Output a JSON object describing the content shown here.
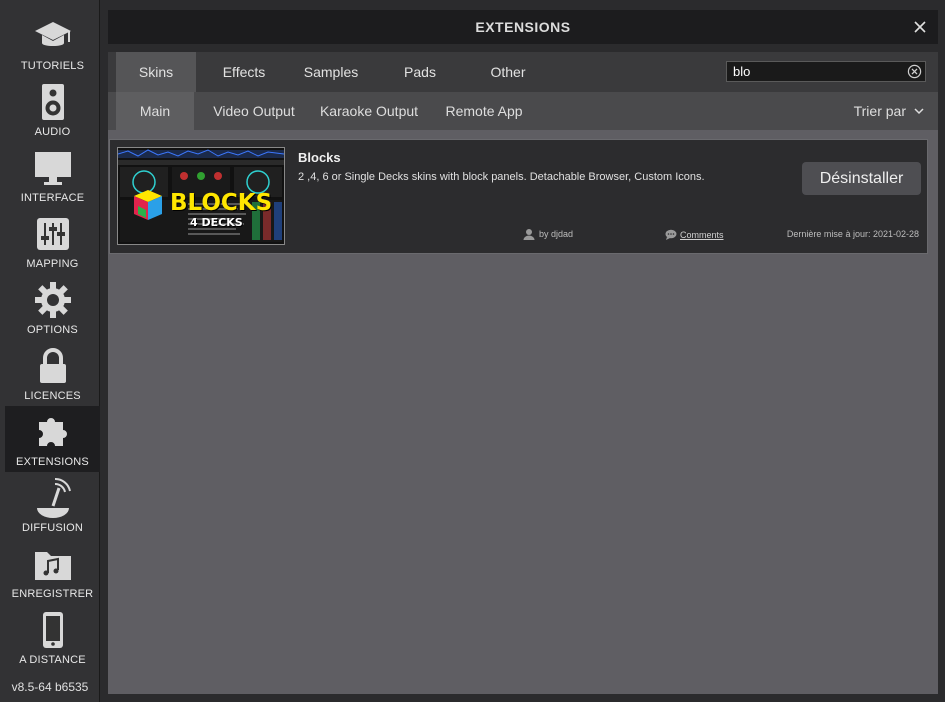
{
  "sidebar": {
    "items": [
      {
        "label": "TUTORIELS",
        "icon": "graduation-cap-icon"
      },
      {
        "label": "AUDIO",
        "icon": "speaker-icon"
      },
      {
        "label": "INTERFACE",
        "icon": "monitor-icon"
      },
      {
        "label": "MAPPING",
        "icon": "sliders-icon"
      },
      {
        "label": "OPTIONS",
        "icon": "gear-icon"
      },
      {
        "label": "LICENCES",
        "icon": "lock-icon"
      },
      {
        "label": "EXTENSIONS",
        "icon": "puzzle-icon"
      },
      {
        "label": "DIFFUSION",
        "icon": "broadcast-icon"
      },
      {
        "label": "ENREGISTRER",
        "icon": "music-folder-icon"
      },
      {
        "label": "A DISTANCE",
        "icon": "phone-icon"
      }
    ],
    "active": "EXTENSIONS",
    "version": "v8.5-64 b6535"
  },
  "window": {
    "title": "EXTENSIONS"
  },
  "category_tabs": [
    "Skins",
    "Effects",
    "Samples",
    "Pads",
    "Other"
  ],
  "active_category": "Skins",
  "search": {
    "value": "blo"
  },
  "sub_tabs": [
    "Main",
    "Video Output",
    "Karaoke Output",
    "Remote App"
  ],
  "active_sub_tab": "Main",
  "sort_label": "Trier par",
  "extension": {
    "name": "Blocks",
    "description": "2 ,4, 6 or Single Decks skins with block panels. Detachable Browser, Custom Icons.",
    "button_label": "Désinstaller",
    "author": "by djdad",
    "comments_label": "Comments",
    "updated": "Dernière mise à jour: 2021-02-28",
    "thumb_logo": "BLOCKS",
    "thumb_sub": "4 DECKS"
  },
  "colors": {
    "sidebar_bg": "#323234",
    "titlebar_bg": "#1c1c1e",
    "content_bg": "#5f5e63",
    "card_bg": "#2c2c2e",
    "logo_yellow": "#ffe600"
  }
}
